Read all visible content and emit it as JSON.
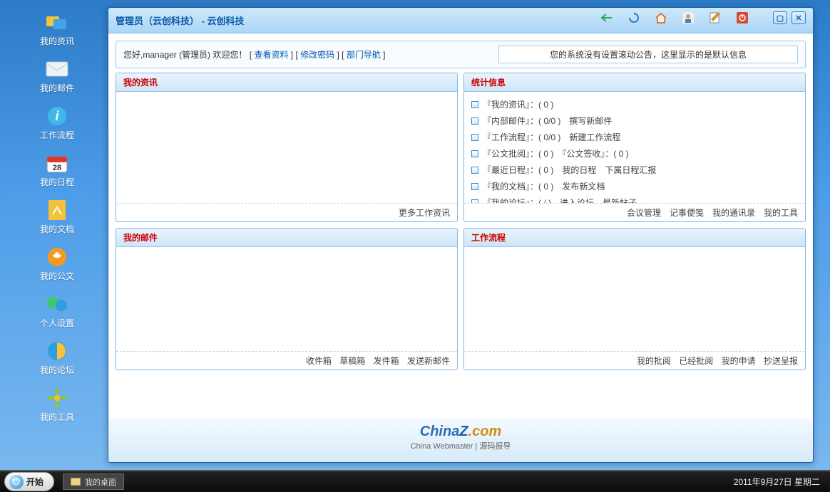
{
  "desktop": [
    {
      "label": "我的资讯",
      "color": "#f5c23a"
    },
    {
      "label": "我的邮件",
      "color": "#e9eef5"
    },
    {
      "label": "工作流程",
      "color": "#3eb6e8"
    },
    {
      "label": "我的日程",
      "color": "#e33b2e",
      "badge": "28"
    },
    {
      "label": "我的文档",
      "color": "#f5c23a"
    },
    {
      "label": "我的公文",
      "color": "#f39a1f"
    },
    {
      "label": "个人设置",
      "color": "#3cc96b"
    },
    {
      "label": "我的论坛",
      "color": "#2f9fe0"
    },
    {
      "label": "我的工具",
      "color": "#f3c22a"
    }
  ],
  "window": {
    "title": "管理员（云创科技） - 云创科技",
    "greeting_prefix": "您好,",
    "user_name": "manager",
    "user_role": "(管理员)",
    "welcome": "欢迎您！",
    "links": {
      "view_profile": "查看资料",
      "change_password": "修改密码",
      "dept_nav": "部门导航"
    },
    "announcement": "您的系统没有设置滚动公告，这里显示的是默认信息"
  },
  "panels": {
    "news": {
      "title": "我的资讯",
      "more": "更多工作资讯"
    },
    "stats": {
      "title": "统计信息",
      "rows": [
        {
          "text": "『我的资讯』：( 0 )"
        },
        {
          "text": "『内部邮件』：( 0/0 )　撰写新邮件"
        },
        {
          "text": "『工作流程』：( 0/0 )　新建工作流程"
        },
        {
          "text": "『公文批阅』：( 0 )　『公文签收』：( 0 )"
        },
        {
          "text": "『最近日程』：( 0 )　我的日程　下属日程汇报"
        },
        {
          "text": "『我的文档』：( 0 )　发布新文档"
        },
        {
          "text": "『我的论坛』：( / )　进入论坛　最新帖子"
        }
      ],
      "footer": "会议管理　记事便笺　我的通讯录　我的工具"
    },
    "mail": {
      "title": "我的邮件",
      "footer_items": [
        "收件箱",
        "草稿箱",
        "发件箱",
        "发送新邮件"
      ]
    },
    "workflow": {
      "title": "工作流程",
      "footer_items": [
        "我的批阅",
        "已经批阅",
        "我的申请",
        "抄送呈报"
      ]
    }
  },
  "brand": {
    "main_a": "China",
    "main_b": "Z",
    "main_c": ".com",
    "sub": "China Webmaster | 源码报导"
  },
  "taskbar": {
    "start": "开始",
    "task_item": "我的桌面",
    "clock": "2011年9月27日 星期二"
  }
}
